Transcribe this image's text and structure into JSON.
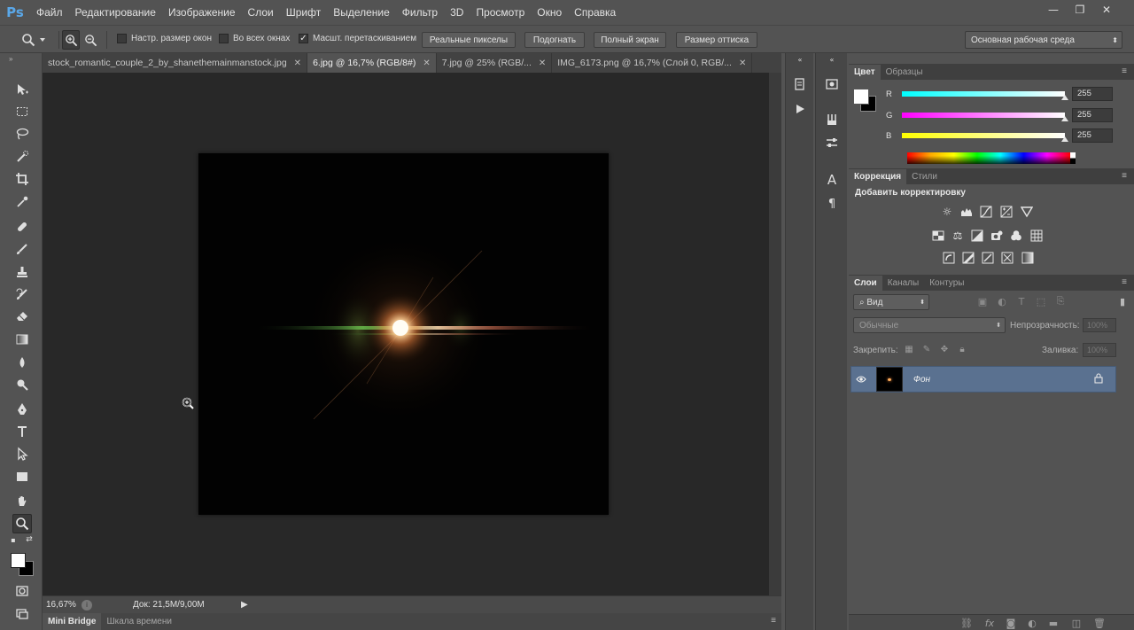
{
  "app": {
    "logo": "Ps"
  },
  "menu": [
    "Файл",
    "Редактирование",
    "Изображение",
    "Слои",
    "Шрифт",
    "Выделение",
    "Фильтр",
    "3D",
    "Просмотр",
    "Окно",
    "Справка"
  ],
  "window_controls": {
    "minimize": "—",
    "restore": "❐",
    "close": "✕"
  },
  "options": {
    "resize_windows_label": "Настр. размер окон",
    "resize_windows_checked": false,
    "all_windows_label": "Во всех окнах",
    "all_windows_checked": false,
    "scrubby_zoom_label": "Масшт. перетаскиванием",
    "scrubby_zoom_checked": true,
    "actual_pixels": "Реальные пикселы",
    "fit_screen": "Подогнать",
    "fill_screen": "Полный экран",
    "print_size": "Размер оттиска",
    "workspace": "Основная рабочая среда"
  },
  "tabs": [
    {
      "title": "stock_romantic_couple_2_by_shanethemainmanstock.jpg",
      "close": "✕",
      "active": false
    },
    {
      "title": "6.jpg @ 16,7% (RGB/8#)",
      "close": "✕",
      "active": true
    },
    {
      "title": "7.jpg @ 25% (RGB/...",
      "close": "✕",
      "active": false
    },
    {
      "title": "IMG_6173.png @ 16,7% (Слой 0, RGB/...",
      "close": "✕",
      "active": false
    }
  ],
  "status": {
    "zoom": "16,67%",
    "doc_info": "Док: 21,5M/9,00M",
    "arrow": "▶"
  },
  "bottom_tabs": [
    "Mini Bridge",
    "Шкала времени"
  ],
  "color_panel": {
    "tabs": [
      "Цвет",
      "Образцы"
    ],
    "channels": [
      {
        "label": "R",
        "value": "255",
        "gradient": "linear-gradient(to right,#00ffff,#ffffff)"
      },
      {
        "label": "G",
        "value": "255",
        "gradient": "linear-gradient(to right,#ff00ff,#ffffff)"
      },
      {
        "label": "B",
        "value": "255",
        "gradient": "linear-gradient(to right,#ffff00,#ffffff)"
      }
    ],
    "foreground": "#ffffff",
    "background": "#000000"
  },
  "adjustments_panel": {
    "tabs": [
      "Коррекция",
      "Стили"
    ],
    "title": "Добавить корректировку"
  },
  "layers_panel": {
    "tabs": [
      "Слои",
      "Каналы",
      "Контуры"
    ],
    "filter": "Вид",
    "blend_mode": "Обычные",
    "opacity_label": "Непрозрачность:",
    "opacity_value": "100%",
    "lock_label": "Закрепить:",
    "fill_label": "Заливка:",
    "fill_value": "100%",
    "layers": [
      {
        "name": "Фон",
        "visible": true,
        "locked": true
      }
    ]
  },
  "colors": {
    "accent_selection": "#5a7190",
    "canvas_bg": "#282828",
    "panel_bg": "#535353"
  }
}
